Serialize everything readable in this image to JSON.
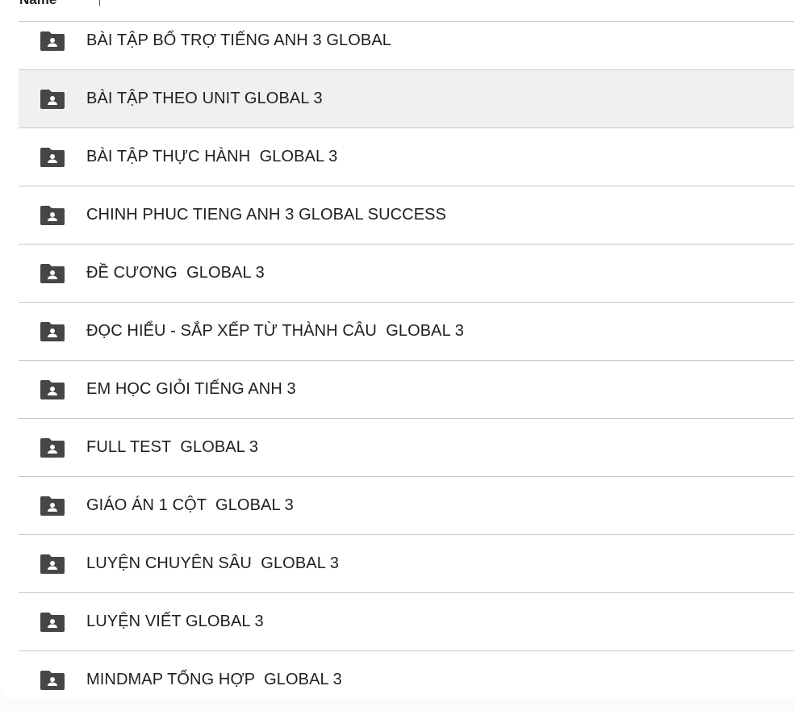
{
  "header": {
    "name_label": "Name",
    "sort_icon": "arrow-up-icon"
  },
  "colors": {
    "hover_row": "#f0f0f0",
    "icon": "#444746",
    "divider": "#c7c7c7"
  },
  "folders": [
    {
      "label": "BÀI TẬP BỔ TRỢ TIẾNG ANH 3 GLOBAL"
    },
    {
      "label": "BÀI TẬP THEO UNIT GLOBAL 3",
      "hovered": true
    },
    {
      "label": "BÀI TẬP THỰC HÀNH  GLOBAL 3"
    },
    {
      "label": "CHINH PHUC TIENG ANH 3 GLOBAL SUCCESS"
    },
    {
      "label": "ĐỀ CƯƠNG  GLOBAL 3"
    },
    {
      "label": "ĐỌC HIỂU - SẮP XẾP TỪ THÀNH CÂU  GLOBAL 3"
    },
    {
      "label": "EM HỌC GIỎI TIẾNG ANH 3"
    },
    {
      "label": "FULL TEST  GLOBAL 3"
    },
    {
      "label": "GIÁO ÁN 1 CỘT  GLOBAL 3"
    },
    {
      "label": "LUYỆN CHUYÊN SÂU  GLOBAL 3"
    },
    {
      "label": "LUYỆN VIẾT GLOBAL 3"
    },
    {
      "label": "MINDMAP TỔNG HỢP  GLOBAL 3"
    }
  ]
}
